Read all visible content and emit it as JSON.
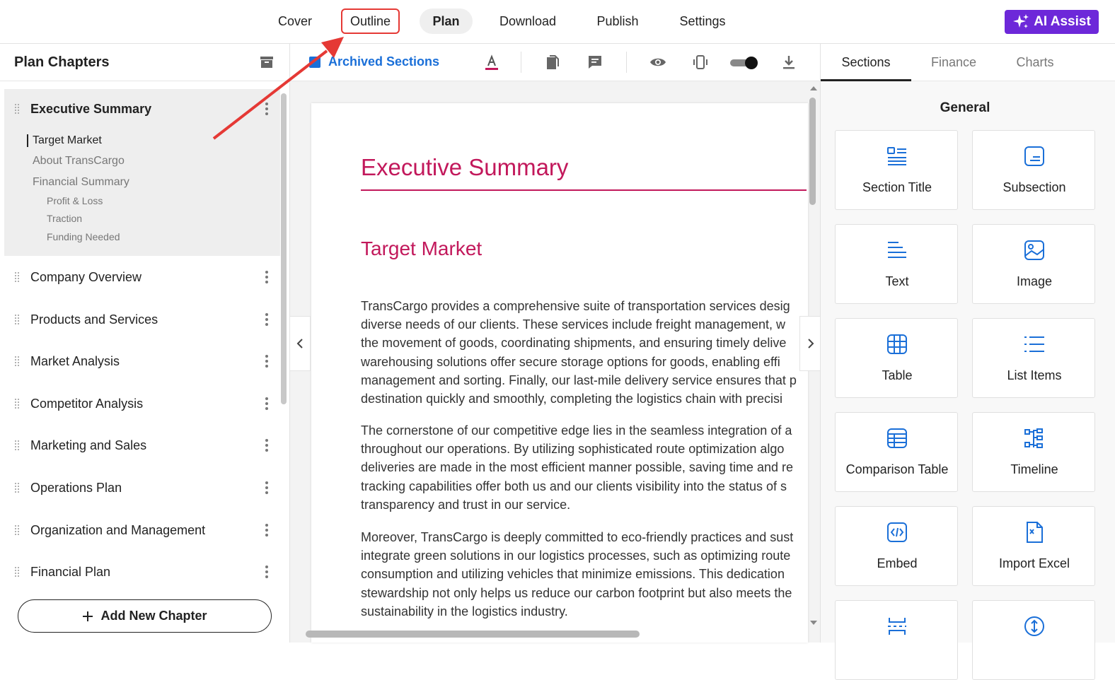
{
  "topnav": {
    "items": [
      {
        "label": "Cover"
      },
      {
        "label": "Outline"
      },
      {
        "label": "Plan"
      },
      {
        "label": "Download"
      },
      {
        "label": "Publish"
      },
      {
        "label": "Settings"
      }
    ],
    "active": "Plan",
    "highlighted": "Outline",
    "ai_assist_label": "AI Assist",
    "ai_assist_color": "#6d28d9"
  },
  "sidebar": {
    "title": "Plan Chapters",
    "active_chapter": {
      "label": "Executive Summary",
      "subsections": [
        "Target Market",
        "About TransCargo",
        "Financial Summary"
      ],
      "sub_subsections": [
        "Profit & Loss",
        "Traction",
        "Funding Needed"
      ]
    },
    "chapters": [
      "Company Overview",
      "Products and Services",
      "Market Analysis",
      "Competitor Analysis",
      "Marketing and Sales",
      "Operations Plan",
      "Organization and Management",
      "Financial Plan"
    ],
    "add_chapter_label": "Add New Chapter"
  },
  "editor": {
    "archived_label": "Archived Sections",
    "accent_color": "#c2185b",
    "link_color": "#1a6fd8",
    "doc": {
      "heading": "Executive Summary",
      "subheading": "Target Market",
      "para1": [
        "TransCargo provides a comprehensive suite of transportation services desig",
        "diverse needs of our clients. These services include freight management, w",
        "the movement of goods, coordinating shipments, and ensuring timely delive",
        "warehousing solutions offer secure storage options for goods, enabling effi",
        "management and sorting. Finally, our last-mile delivery service ensures that p",
        "destination quickly and smoothly, completing the logistics chain with precisi"
      ],
      "para2": [
        "The cornerstone of our competitive edge lies in the seamless integration of a",
        "throughout our operations. By utilizing sophisticated route optimization algo",
        "deliveries are made in the most efficient manner possible, saving time and re",
        "tracking capabilities offer both us and our clients visibility into the status of s",
        "transparency and trust in our service."
      ],
      "para3": [
        "Moreover, TransCargo is deeply committed to eco-friendly practices and sust",
        "integrate green solutions in our logistics processes, such as optimizing route",
        "consumption and utilizing vehicles that minimize emissions. This dedication",
        "stewardship not only helps us reduce our carbon footprint but also meets the",
        "sustainability in the logistics industry."
      ]
    }
  },
  "rpanel": {
    "tabs": [
      "Sections",
      "Finance",
      "Charts"
    ],
    "active_tab": "Sections",
    "group_title": "General",
    "icon_color": "#1a6fd8",
    "cards": [
      {
        "label": "Section Title",
        "icon": "section-title-icon"
      },
      {
        "label": "Subsection",
        "icon": "subsection-icon"
      },
      {
        "label": "Text",
        "icon": "text-icon"
      },
      {
        "label": "Image",
        "icon": "image-icon"
      },
      {
        "label": "Table",
        "icon": "table-icon"
      },
      {
        "label": "List Items",
        "icon": "list-items-icon"
      },
      {
        "label": "Comparison Table",
        "icon": "comparison-table-icon"
      },
      {
        "label": "Timeline",
        "icon": "timeline-icon"
      },
      {
        "label": "Embed",
        "icon": "embed-icon"
      },
      {
        "label": "Import Excel",
        "icon": "import-excel-icon"
      },
      {
        "label": "",
        "icon": "page-break-icon"
      },
      {
        "label": "",
        "icon": "spacer-icon"
      }
    ]
  },
  "annotation": {
    "arrow_color": "#e53935"
  }
}
